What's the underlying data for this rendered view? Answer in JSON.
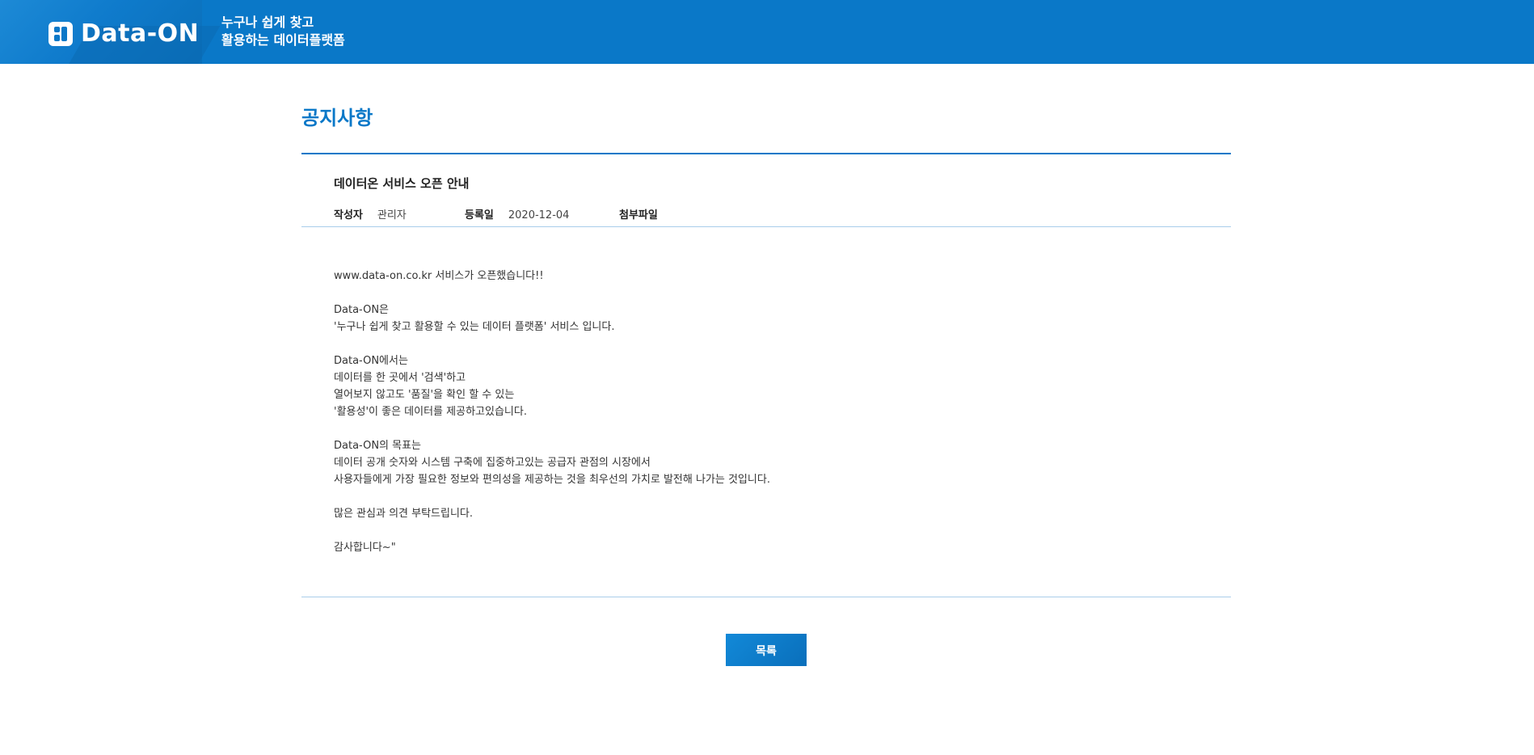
{
  "header": {
    "logo_text": "Data-ON",
    "tagline_line1": "누구나 쉽게 찾고",
    "tagline_line2": "활용하는 데이터플랫폼",
    "brand_color": "#0a78c8"
  },
  "page": {
    "title": "공지사항"
  },
  "post": {
    "title": "데이터온 서비스 오픈 안내",
    "author_label": "작성자",
    "author": "관리자",
    "date_label": "등록일",
    "date": "2020-12-04",
    "attachment_label": "첨부파일",
    "body": [
      "www.data-on.co.kr 서비스가 오픈했습니다!!",
      "",
      "Data-ON은",
      "'누구나 쉽게 찾고 활용할 수 있는 데이터 플랫폼' 서비스 입니다.",
      "",
      "Data-ON에서는",
      "데이터를 한 곳에서 '검색'하고",
      "열어보지 않고도 '품질'을 확인 할 수 있는",
      "'활용성'이 좋은 데이터를 제공하고있습니다.",
      "",
      "Data-ON의 목표는",
      "데이터 공개 숫자와 시스템 구축에 집중하고있는 공급자 관점의 시장에서",
      "사용자들에게 가장 필요한 정보와 편의성을 제공하는 것을 최우선의 가치로 발전해 나가는 것입니다.",
      "",
      "많은 관심과 의견 부탁드립니다.",
      "",
      "감사합니다~\""
    ]
  },
  "actions": {
    "list_button_label": "목록"
  }
}
